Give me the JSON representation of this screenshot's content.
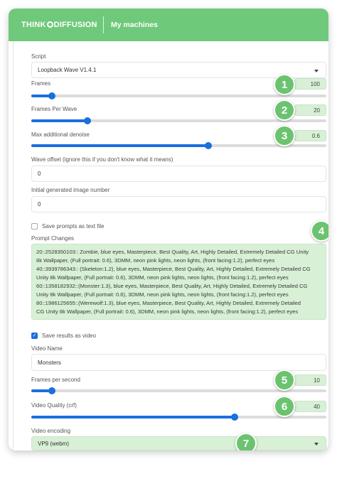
{
  "header": {
    "logo_text_left": "THINK",
    "logo_text_right": "DIFFUSION",
    "title": "My machines"
  },
  "script": {
    "label": "Script",
    "selected": "Loopback Wave V1.4.1"
  },
  "frames": {
    "label": "Frames",
    "value": "100",
    "fraction": 0.07
  },
  "frames_per_wave": {
    "label": "Frames Per Wave",
    "value": "20",
    "fraction": 0.19
  },
  "max_denoise": {
    "label": "Max additional denoise",
    "value": "0.6",
    "fraction": 0.6
  },
  "wave_offset": {
    "label": "Wave offset (ignore this if you don't know what it means)",
    "value": "0"
  },
  "initial_image": {
    "label": "Initial generated image number",
    "value": "0"
  },
  "save_prompts": {
    "label": "Save prompts as text file",
    "checked": false
  },
  "prompt_changes": {
    "label": "Prompt Changes",
    "lines": [
      "20::2528350103:: Zombie, blue eyes, Masterpiece, Best Quality, Art, Highly Detailed, Extremely Detailed CG Unity",
      "8k Wallpaper, (Full portrait: 0.6), 3DMM, neon pink lights, neon lights, (front facing:1.2), perfect eyes",
      "40::3939786343:: (Skeleton:1.2), blue eyes, Masterpiece, Best Quality, Art, Highly Detailed, Extremely Detailed CG",
      "Unity 8k Wallpaper, (Full portrait: 0.6), 3DMM, neon pink lights, neon lights, (front facing:1.2), perfect eyes",
      "60::1358182932::(Monster:1.3), blue eyes, Masterpiece, Best Quality, Art, Highly Detailed, Extremely Detailed CG",
      "Unity 8k Wallpaper, (Full portrait: 0.6), 3DMM, neon pink lights, neon lights, (front facing:1.2), perfect eyes",
      "80::1986125655::(Werewolf:1.3), blue eyes, Masterpiece, Best Quality, Art, Highly Detailed, Extremely Detailed",
      "CG Unity 8k Wallpaper, (Full portrait: 0.6), 3DMM, neon pink lights, neon lights, (front facing:1.2), perfect eyes"
    ]
  },
  "save_video": {
    "label": "Save results as video",
    "checked": true
  },
  "video_name": {
    "label": "Video Name",
    "value": "Monsters"
  },
  "fps": {
    "label": "Frames per second",
    "value": "10",
    "fraction": 0.07
  },
  "video_quality": {
    "label": "Video Quality (crf)",
    "value": "40",
    "fraction": 0.69
  },
  "video_encoding": {
    "label": "Video encoding",
    "selected": "VP9 (webm)"
  },
  "badges": [
    "1",
    "2",
    "3",
    "4",
    "5",
    "6",
    "7"
  ],
  "colors": {
    "accent_green": "#6fc97b",
    "slider_blue": "#1a6fe0",
    "highlight_green": "#d8f0d6",
    "badge_green": "#6cc36f"
  }
}
